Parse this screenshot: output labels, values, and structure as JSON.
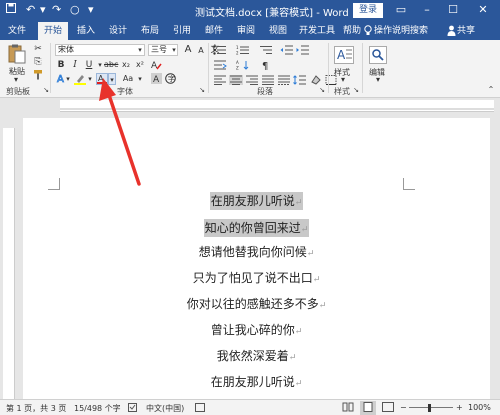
{
  "titlebar": {
    "title": "测试文档.docx [兼容模式] - Word",
    "login": "登录"
  },
  "tabs": [
    {
      "label": "文件"
    },
    {
      "label": "开始"
    },
    {
      "label": "插入"
    },
    {
      "label": "设计"
    },
    {
      "label": "布局"
    },
    {
      "label": "引用"
    },
    {
      "label": "邮件"
    },
    {
      "label": "审阅"
    },
    {
      "label": "视图"
    },
    {
      "label": "开发工具"
    },
    {
      "label": "帮助"
    }
  ],
  "tell_me": "操作说明搜索",
  "share": "共享",
  "ribbon": {
    "paste_label": "粘贴",
    "font_name": "宋体",
    "font_size": "三号",
    "font_grow": "A",
    "font_shrink": "A",
    "aa_label": "Aa",
    "wen_label": "文",
    "style_label": "样式",
    "edit_label": "编辑",
    "groups": {
      "clipboard": "剪贴板",
      "font": "字体",
      "paragraph": "段落",
      "styles": "样式"
    }
  },
  "document": {
    "lines": [
      "在朋友那儿听说",
      "知心的你曾回来过",
      "想请他替我向你问候",
      "只为了怕见了说不出口",
      "你对以往的感触还多不多",
      "曾让我心碎的你",
      "我依然深爱着",
      "在朋友那儿听说"
    ],
    "paragraph_mark": "↵"
  },
  "status": {
    "page": "第 1 页，共 3 页",
    "words": "15/498 个字",
    "lang": "中文(中国)",
    "zoom": "100%"
  },
  "colors": {
    "brand": "#2b579a",
    "font_color": "#e02020",
    "highlight": "#ffff00",
    "arrow": "#e8322b"
  }
}
